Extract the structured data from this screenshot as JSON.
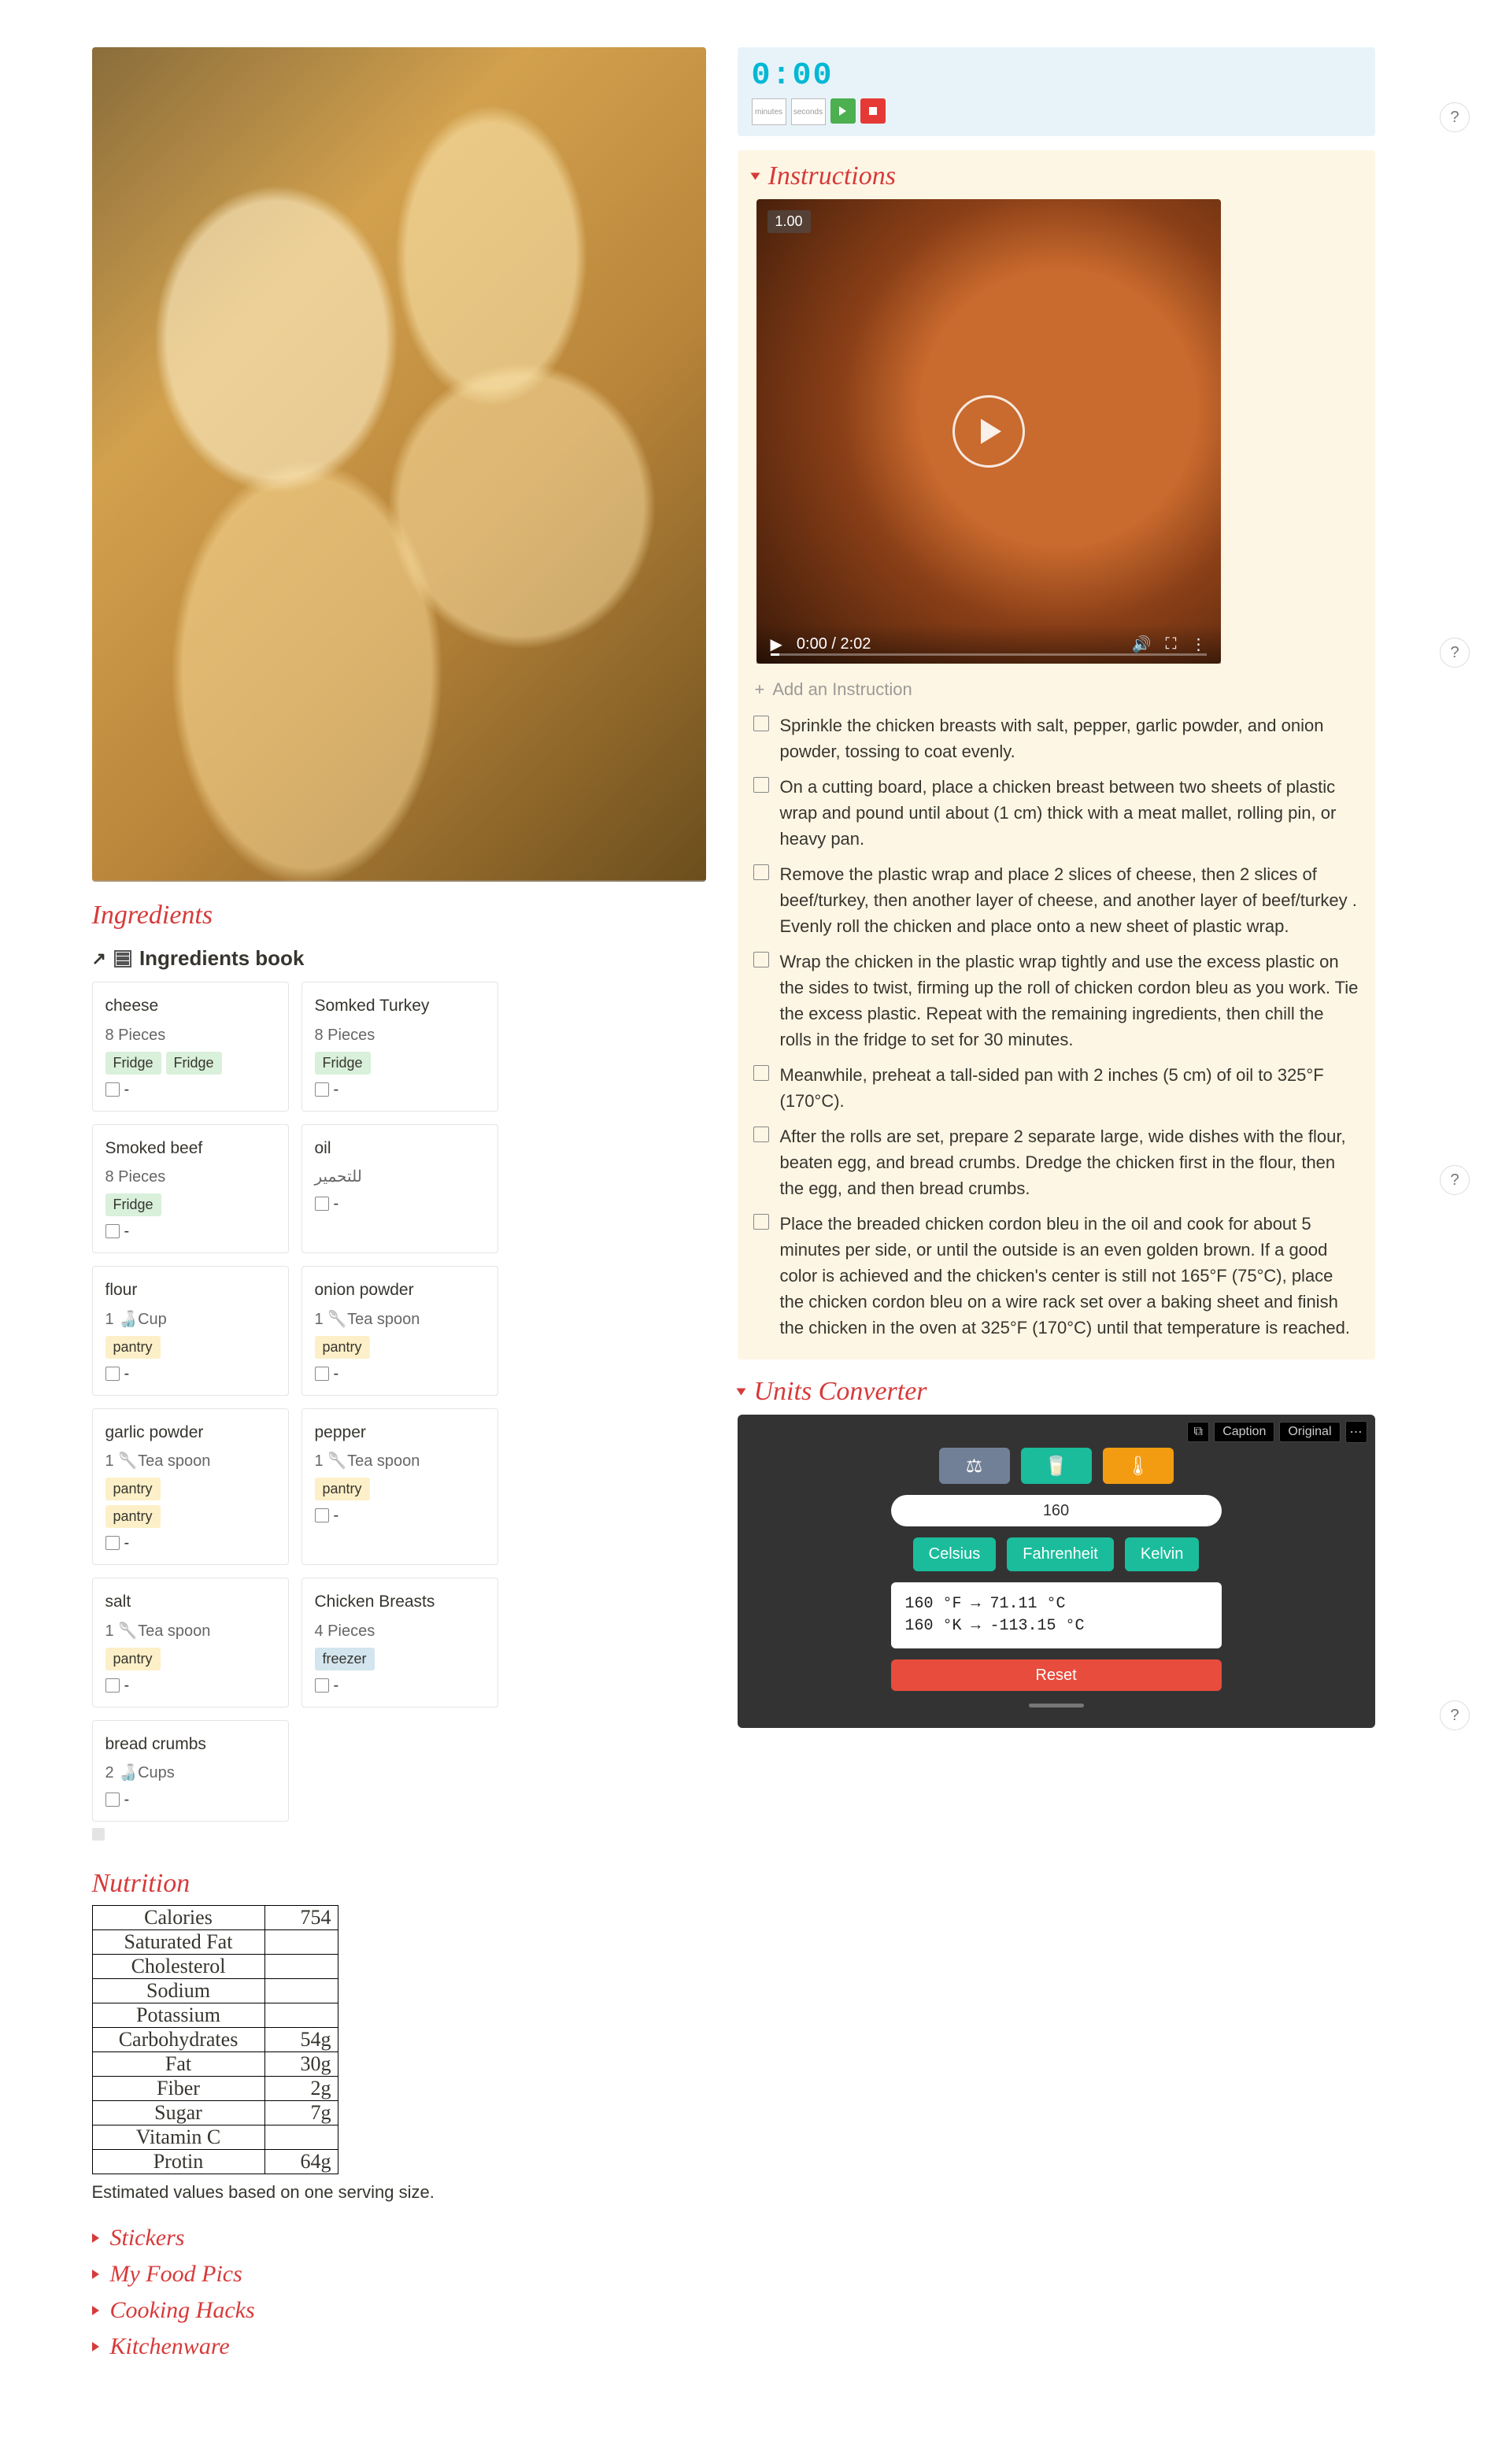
{
  "sections": {
    "ingredients": "Ingredients",
    "ingredients_book": "Ingredients book",
    "nutrition": "Nutrition",
    "instructions": "Instructions",
    "units_converter": "Units  Converter",
    "stickers": "Stickers",
    "my_food_pics": "My Food  Pics",
    "cooking_hacks": "Cooking Hacks",
    "kitchenware": "Kitchenware"
  },
  "timer": {
    "display": "0:00",
    "minutes_label": "minutes",
    "seconds_label": "seconds"
  },
  "video": {
    "speed": "1.00",
    "time": "0:00 / 2:02"
  },
  "add_instruction": "Add an Instruction",
  "ingredients_list": [
    {
      "name": "cheese",
      "qty": "8 Pieces",
      "tags": [
        {
          "t": "Fridge",
          "c": "green"
        },
        {
          "t": "Fridge",
          "c": "green"
        }
      ]
    },
    {
      "name": "Somked Turkey",
      "qty": "8 Pieces",
      "tags": [
        {
          "t": "Fridge",
          "c": "green"
        }
      ]
    },
    {
      "name": "Smoked beef",
      "qty": "8 Pieces",
      "tags": [
        {
          "t": "Fridge",
          "c": "green"
        }
      ]
    },
    {
      "name": "oil",
      "qty": "للتحمير",
      "tags": []
    },
    {
      "name": "flour",
      "qty": "1 🍶Cup",
      "tags": [
        {
          "t": "pantry",
          "c": "yellow"
        }
      ],
      "pantry_after": false
    },
    {
      "name": "onion powder",
      "qty": "1 🥄Tea spoon",
      "tags": [
        {
          "t": "pantry",
          "c": "yellow"
        }
      ]
    },
    {
      "name": "garlic powder",
      "qty": "1 🥄Tea spoon",
      "tags": [
        {
          "t": "pantry",
          "c": "yellow"
        }
      ],
      "pantry_before": true
    },
    {
      "name": "pepper",
      "qty": "1 🥄Tea spoon",
      "tags": [
        {
          "t": "pantry",
          "c": "yellow"
        }
      ]
    },
    {
      "name": "salt",
      "qty": "1 🥄Tea spoon",
      "tags": [
        {
          "t": "pantry",
          "c": "yellow"
        }
      ]
    },
    {
      "name": "Chicken Breasts",
      "qty": "4 Pieces",
      "tags": [
        {
          "t": "freezer",
          "c": "blue"
        }
      ]
    },
    {
      "name": "bread crumbs",
      "qty": "2 🍶Cups",
      "tags": []
    }
  ],
  "instructions": [
    "Sprinkle the chicken breasts with salt, pepper, garlic powder, and onion powder, tossing to coat evenly.",
    "On a cutting board, place a chicken breast between two sheets of plastic wrap and pound until about  (1 cm) thick with a meat mallet, rolling pin, or heavy pan.",
    "Remove the plastic wrap and place 2 slices of cheese, then 2 slices of beef/turkey, then another layer of cheese, and another layer of beef/turkey . Evenly roll the chicken and place onto a new sheet of plastic wrap.",
    "Wrap the chicken in the plastic wrap tightly and use the excess plastic on the sides to twist, firming up the roll of chicken cordon bleu as you work. Tie the excess plastic. Repeat with the remaining ingredients, then chill the rolls in the fridge to set for 30 minutes.",
    "Meanwhile, preheat a tall-sided pan with 2 inches (5 cm) of oil to 325°F (170°C).",
    "After the rolls are set, prepare 2 separate large, wide dishes with the flour, beaten egg, and bread crumbs. Dredge the chicken first in the flour, then the egg, and then bread crumbs.",
    "Place the breaded chicken cordon bleu in the oil and cook for about 5 minutes per side, or until the outside is an even golden brown. If a good color is achieved and the chicken's center is still not 165°F (75°C), place the chicken cordon bleu on a wire rack set over a baking sheet and finish the chicken in the oven at 325°F (170°C) until that temperature is reached."
  ],
  "nutrition": [
    {
      "k": "Calories",
      "v": "754"
    },
    {
      "k": "Saturated Fat",
      "v": ""
    },
    {
      "k": "Cholesterol",
      "v": ""
    },
    {
      "k": "Sodium",
      "v": ""
    },
    {
      "k": "Potassium",
      "v": ""
    },
    {
      "k": "Carbohydrates",
      "v": "54g"
    },
    {
      "k": "Fat",
      "v": "30g"
    },
    {
      "k": "Fiber",
      "v": "2g"
    },
    {
      "k": "Sugar",
      "v": "7g"
    },
    {
      "k": "Vitamin C",
      "v": ""
    },
    {
      "k": "Protin",
      "v": "64g"
    }
  ],
  "nutrition_note": "Estimated values based on one serving size.",
  "converter": {
    "top_chips": [
      "Caption",
      "Original"
    ],
    "input": "160",
    "units": [
      "Celsius",
      "Fahrenheit",
      "Kelvin"
    ],
    "output": "160 °F → 71.11 °C\n160 °K → -113.15 °C",
    "reset": "Reset"
  },
  "dash": "-",
  "help": "?"
}
